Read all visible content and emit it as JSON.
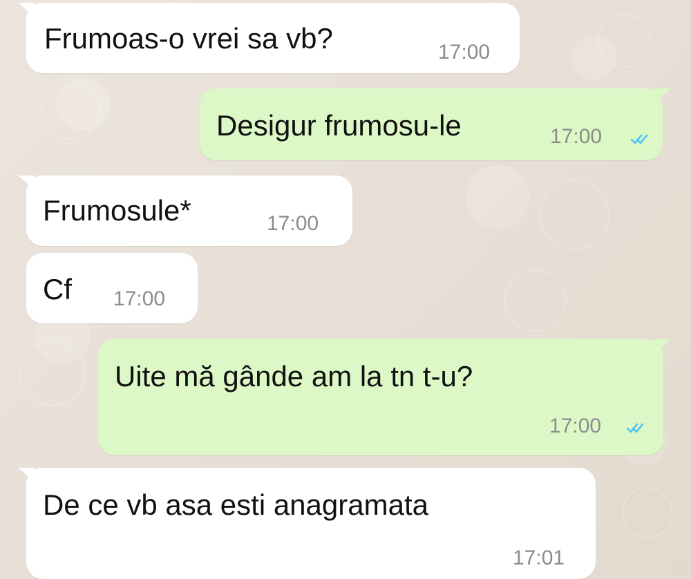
{
  "conversation": {
    "messages": [
      {
        "direction": "incoming",
        "text": "Frumoas-o vrei sa vb?",
        "time": "17:00",
        "read_receipt": ""
      },
      {
        "direction": "outgoing",
        "text": "Desigur frumosu-le",
        "time": "17:00",
        "read_receipt": "double-check-read"
      },
      {
        "direction": "incoming",
        "text": "Frumosule*",
        "time": "17:00",
        "read_receipt": ""
      },
      {
        "direction": "incoming",
        "text": "Cf",
        "time": "17:00",
        "read_receipt": ""
      },
      {
        "direction": "outgoing",
        "text": "Uite mă gânde am la tn t-u?",
        "time": "17:00",
        "read_receipt": "double-check-read"
      },
      {
        "direction": "incoming",
        "text": "De ce vb asa esti anagramata",
        "time": "17:01",
        "read_receipt": ""
      }
    ]
  },
  "theme": {
    "background": "#e7dfd6",
    "incoming_bubble": "#ffffff",
    "outgoing_bubble": "#dcf8c6",
    "message_text": "#111111",
    "timestamp_text": "#8c8c8c",
    "tick_color": "#4fc3f7"
  },
  "icons": {
    "double_check": "double-check-icon"
  }
}
